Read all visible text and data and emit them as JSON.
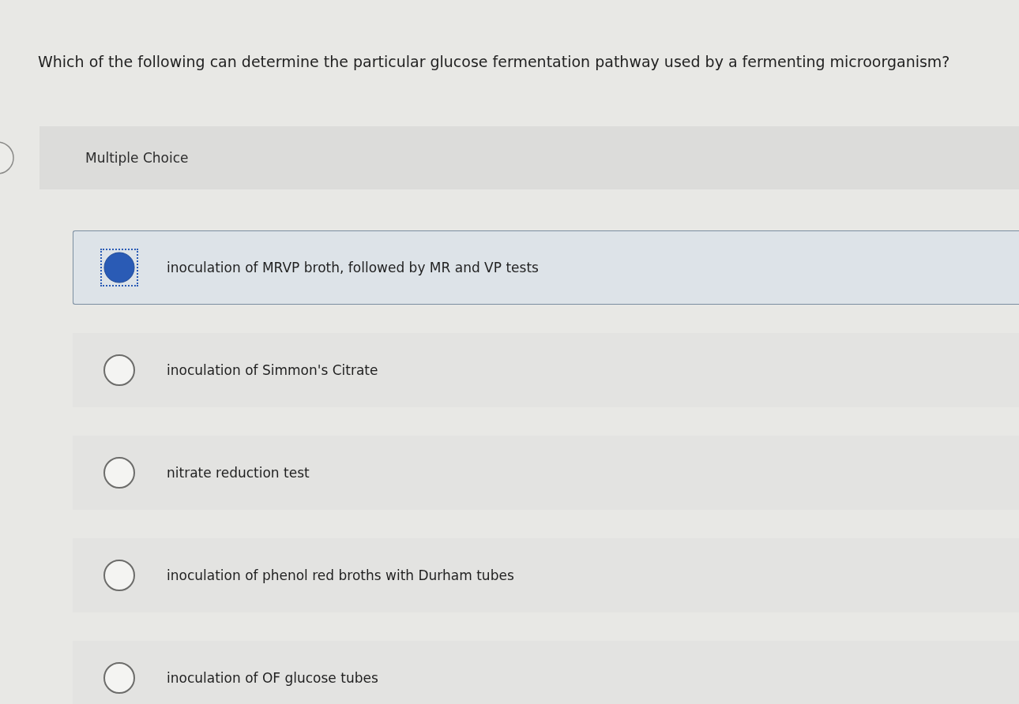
{
  "question": {
    "text": "Which of the following can determine the particular glucose fermentation pathway used by a fermenting microorganism?"
  },
  "answer_panel": {
    "label": "Multiple Choice"
  },
  "options": [
    {
      "label": "inoculation of MRVP broth, followed by MR and VP tests",
      "selected": true,
      "focused": true
    },
    {
      "label": "inoculation of Simmon's Citrate",
      "selected": false,
      "focused": false
    },
    {
      "label": "nitrate reduction test",
      "selected": false,
      "focused": false
    },
    {
      "label": "inoculation of phenol red broths with Durham tubes",
      "selected": false,
      "focused": false
    },
    {
      "label": "inoculation of OF glucose tubes",
      "selected": false,
      "focused": false
    }
  ]
}
